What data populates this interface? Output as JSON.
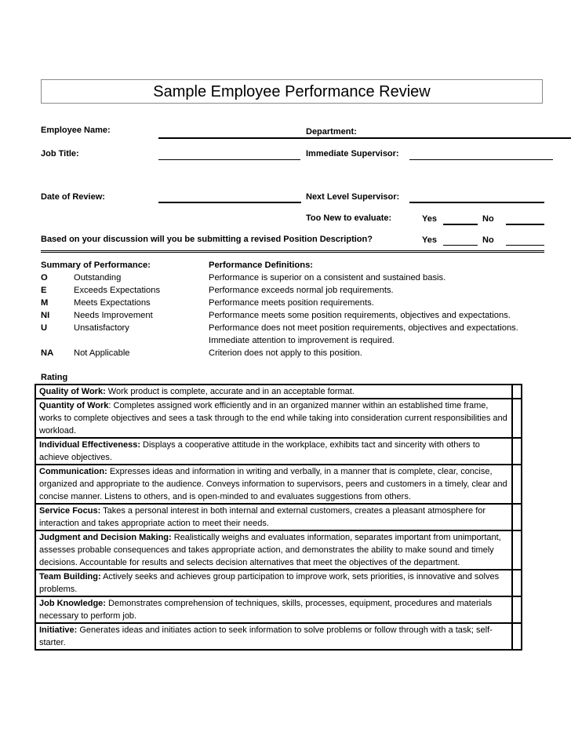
{
  "title": "Sample Employee Performance Review",
  "fields": {
    "employee_name": "Employee Name:",
    "department": "Department:",
    "job_title": "Job Title:",
    "immediate_supervisor": "Immediate Supervisor:",
    "date_of_review": "Date of Review:",
    "next_level_supervisor": "Next Level Supervisor:",
    "too_new": "Too New to evaluate:",
    "revised_position": "Based on your discussion will you be submitting a revised Position Description?",
    "yes": "Yes",
    "no": "No"
  },
  "summary": {
    "heading": "Summary of Performance:",
    "items": [
      {
        "code": "O",
        "label": "Outstanding"
      },
      {
        "code": "E",
        "label": "Exceeds Expectations"
      },
      {
        "code": "M",
        "label": "Meets Expectations"
      },
      {
        "code": "NI",
        "label": "Needs Improvement"
      },
      {
        "code": "U",
        "label": "Unsatisfactory"
      },
      {
        "code": "NA",
        "label": "Not Applicable"
      }
    ]
  },
  "definitions": {
    "heading": "Performance Definitions:",
    "lines": [
      "Performance is superior on a consistent and sustained basis.",
      "Performance exceeds normal job requirements.",
      "Performance meets position requirements.",
      "Performance meets some position requirements, objectives and expectations.",
      "Performance does not meet position requirements, objectives and expectations.",
      "Immediate attention to improvement is required.",
      "Criterion does not apply to this position."
    ]
  },
  "rating": {
    "heading": "Rating",
    "criteria": [
      {
        "name": "Quality of Work:",
        "desc": " Work product is complete, accurate and in an acceptable format."
      },
      {
        "name": "Quantity of Work",
        "desc": ": Completes assigned work efficiently and in an organized manner within an established time frame, works to complete objectives and sees a task through to the end while taking into consideration current responsibilities and workload."
      },
      {
        "name": "Individual Effectiveness:",
        "desc": " Displays a cooperative attitude in the workplace, exhibits tact and sincerity with others to achieve objectives."
      },
      {
        "name": "Communication:",
        "desc": " Expresses ideas and information in writing and verbally, in a manner that is complete, clear, concise, organized and appropriate to the audience.  Conveys information to supervisors, peers and customers in a timely, clear and concise manner.  Listens to others, and is open-minded to and evaluates suggestions from others."
      },
      {
        "name": "Service Focus:",
        "desc": " Takes a personal interest in both internal and external customers, creates a pleasant atmosphere for interaction and takes appropriate action to meet their needs."
      },
      {
        "name": "Judgment and Decision Making:",
        "desc": "  Realistically weighs and evaluates information, separates important from unimportant, assesses probable consequences and takes appropriate action, and demonstrates the ability to make sound and timely decisions.  Accountable for results and selects decision alternatives that meet the objectives of the department."
      },
      {
        "name": "Team Building:",
        "desc": " Actively seeks and achieves group participation to improve work, sets priorities, is innovative and solves problems."
      },
      {
        "name": "Job Knowledge:",
        "desc": " Demonstrates comprehension of techniques, skills, processes, equipment, procedures and materials necessary to perform job."
      },
      {
        "name": "Initiative:",
        "desc": " Generates ideas and initiates action to seek information to solve problems or follow through with a task; self-starter."
      }
    ]
  }
}
